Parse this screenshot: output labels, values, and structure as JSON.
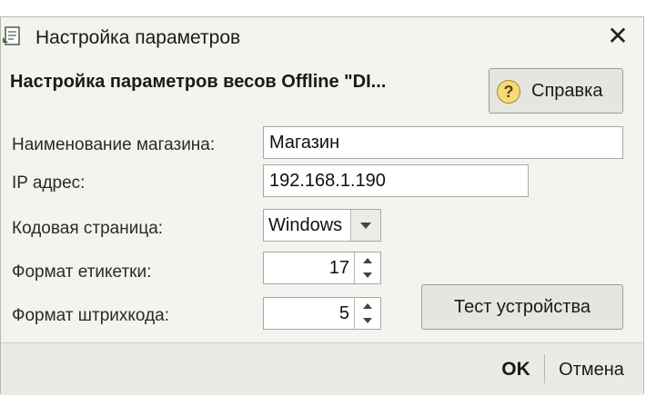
{
  "window": {
    "title": "Настройка параметров",
    "close_label": "✕"
  },
  "header": {
    "heading": "Настройка параметров весов Offline \"DI...",
    "help_label": "Справка",
    "help_icon_glyph": "?"
  },
  "form": {
    "store_name_label": "Наименование магазина:",
    "store_name_value": "Магазин",
    "ip_label": "IP адрес:",
    "ip_value": "192.168.1.190",
    "codepage_label": "Кодовая страница:",
    "codepage_value": "Windows",
    "label_format_label": "Формат етикетки:",
    "label_format_value": "17",
    "barcode_format_label": "Формат штрихкода:",
    "barcode_format_value": "5",
    "test_button_label": "Тест устройства"
  },
  "footer": {
    "ok_label": "OK",
    "cancel_label": "Отмена"
  }
}
